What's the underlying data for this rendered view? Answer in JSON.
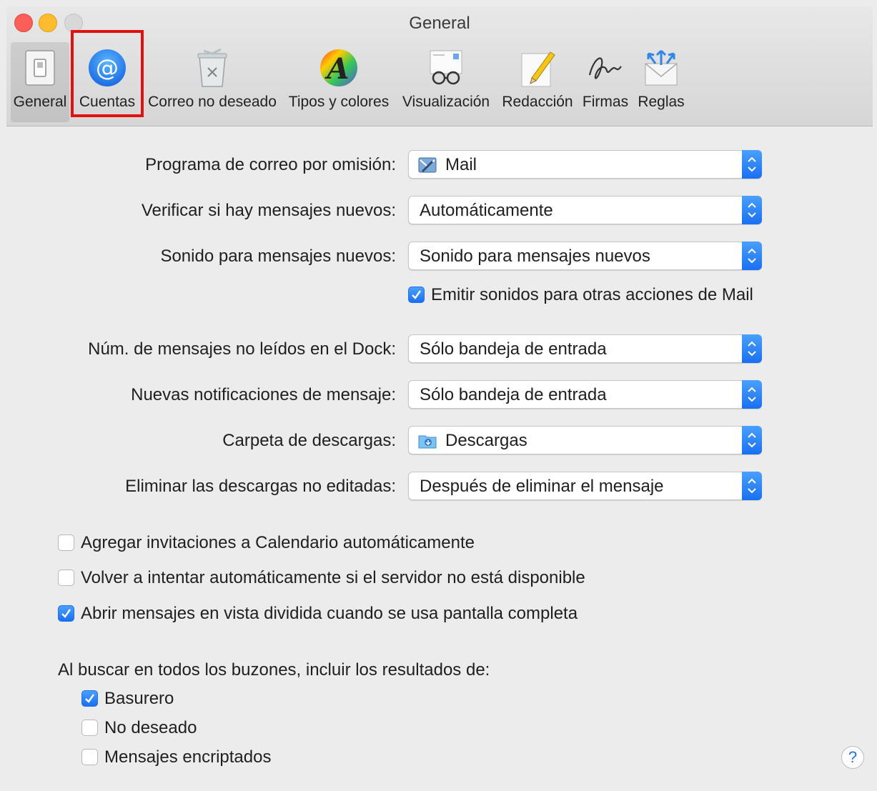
{
  "window": {
    "title": "General"
  },
  "toolbar": {
    "items": [
      {
        "label": "General",
        "icon": "general-switch-icon"
      },
      {
        "label": "Cuentas",
        "icon": "at-sign-icon"
      },
      {
        "label": "Correo no deseado",
        "icon": "junk-trash-icon"
      },
      {
        "label": "Tipos y colores",
        "icon": "font-colors-icon"
      },
      {
        "label": "Visualización",
        "icon": "viewing-glasses-icon"
      },
      {
        "label": "Redacción",
        "icon": "pencil-compose-icon"
      },
      {
        "label": "Firmas",
        "icon": "signature-icon"
      },
      {
        "label": "Reglas",
        "icon": "rules-envelope-icon"
      }
    ],
    "selected": "General",
    "highlighted": "Cuentas",
    "highlight_color": "#e01111"
  },
  "settings": {
    "default_mail": {
      "label": "Programa de correo por omisión:",
      "value": "Mail",
      "icon": "mail-app-icon"
    },
    "check_new": {
      "label": "Verificar si hay mensajes nuevos:",
      "value": "Automáticamente"
    },
    "new_sound": {
      "label": "Sonido para mensajes nuevos:",
      "value": "Sonido para mensajes nuevos"
    },
    "play_sounds": {
      "label": "Emitir sonidos para otras acciones de Mail",
      "checked": true
    },
    "dock_unread": {
      "label": "Núm. de mensajes no leídos en el Dock:",
      "value": "Sólo bandeja de entrada"
    },
    "notifications": {
      "label": "Nuevas notificaciones de mensaje:",
      "value": "Sólo bandeja de entrada"
    },
    "downloads_folder": {
      "label": "Carpeta de descargas:",
      "value": "Descargas",
      "icon": "downloads-folder-icon"
    },
    "remove_downloads": {
      "label": "Eliminar las descargas no editadas:",
      "value": "Después de eliminar el mensaje"
    }
  },
  "options": {
    "add_invitations": {
      "label": "Agregar invitaciones a Calendario automáticamente",
      "checked": false
    },
    "retry_server": {
      "label": "Volver a intentar automáticamente si el servidor no está disponible",
      "checked": false
    },
    "split_view": {
      "label": "Abrir mensajes en vista dividida cuando se usa pantalla completa",
      "checked": true
    }
  },
  "search": {
    "title": "Al buscar en todos los buzones, incluir los resultados de:",
    "trash": {
      "label": "Basurero",
      "checked": true
    },
    "junk": {
      "label": "No deseado",
      "checked": false
    },
    "encrypted": {
      "label": "Mensajes encriptados",
      "checked": false
    }
  },
  "help": {
    "label": "?"
  },
  "colors": {
    "accent": "#1a6ff2",
    "window_bg": "#ececec"
  }
}
